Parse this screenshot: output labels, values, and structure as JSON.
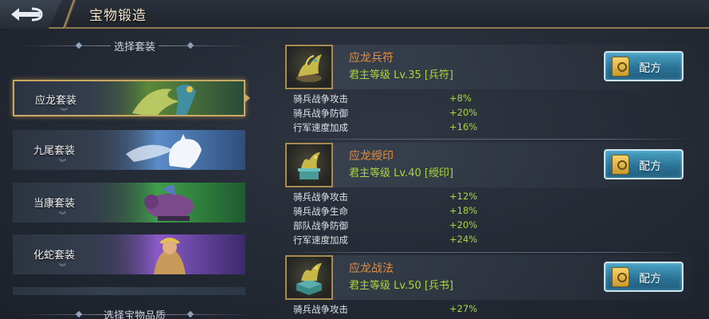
{
  "header": {
    "title": "宝物锻造",
    "back_icon": "back-arrow-icon"
  },
  "left_panel": {
    "section_title": "选择套装",
    "sets": [
      {
        "label": "应龙套装",
        "art": "golden-dragon",
        "color": "#7fb24a",
        "selected": true
      },
      {
        "label": "九尾套装",
        "art": "nine-tailed-fox",
        "color": "#6ea2d6",
        "selected": false
      },
      {
        "label": "当康套装",
        "art": "boar-beast",
        "color": "#5aa05a",
        "selected": false
      },
      {
        "label": "化蛇套装",
        "art": "serpent-maiden",
        "color": "#8f6ac2",
        "selected": false
      }
    ],
    "quality_section_title": "选择宝物品质"
  },
  "items": [
    {
      "name": "应龙兵符",
      "requirement": "君主等级 Lv.35 [兵符]",
      "icon": "dragon-token-icon",
      "button_label": "配方",
      "stats": [
        {
          "name": "骑兵战争攻击",
          "value": "+8%"
        },
        {
          "name": "骑兵战争防御",
          "value": "+20%"
        },
        {
          "name": "行军速度加成",
          "value": "+16%"
        }
      ]
    },
    {
      "name": "应龙绶印",
      "requirement": "君主等级 Lv.40 [绶印]",
      "icon": "dragon-seal-icon",
      "button_label": "配方",
      "stats": [
        {
          "name": "骑兵战争攻击",
          "value": "+12%"
        },
        {
          "name": "骑兵战争生命",
          "value": "+18%"
        },
        {
          "name": "部队战争防御",
          "value": "+20%"
        },
        {
          "name": "行军速度加成",
          "value": "+24%"
        }
      ]
    },
    {
      "name": "应龙战法",
      "requirement": "君主等级 Lv.50 [兵书]",
      "icon": "dragon-book-icon",
      "button_label": "配方",
      "stats": [
        {
          "name": "骑兵战争攻击",
          "value": "+27%"
        }
      ]
    }
  ],
  "colors": {
    "item_name": "#e98c3c",
    "requirement": "#a9d63f",
    "stat_value": "#a9d63f",
    "selected_border": "#c9a866",
    "recipe_button": "#2c7396"
  }
}
